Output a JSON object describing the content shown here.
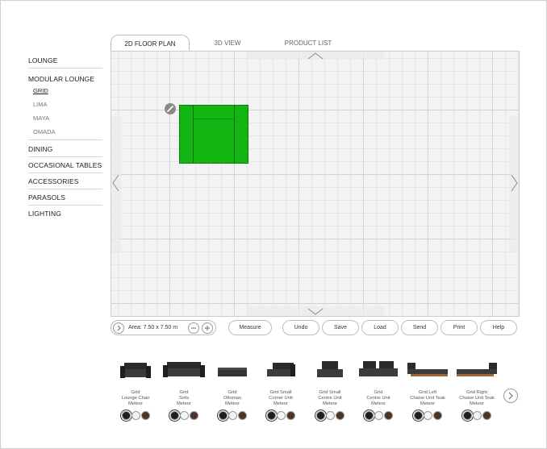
{
  "sidebar": {
    "categories": [
      {
        "label": "LOUNGE"
      },
      {
        "label": "MODULAR LOUNGE",
        "subitems": [
          "GRID",
          "LIMA",
          "MAYA",
          "OMADA"
        ]
      },
      {
        "label": "DINING"
      },
      {
        "label": "OCCASIONAL TABLES"
      },
      {
        "label": "ACCESSORIES"
      },
      {
        "label": "PARASOLS"
      },
      {
        "label": "LIGHTING"
      }
    ],
    "active_subitem": "GRID"
  },
  "tabs": [
    {
      "label": "2D FLOOR PLAN",
      "active": true
    },
    {
      "label": "3D VIEW",
      "active": false
    },
    {
      "label": "PRODUCT LIST",
      "active": false
    }
  ],
  "floor_plan": {
    "placed_item_color": "#13b513",
    "pan_arrows": [
      "chevron-up",
      "chevron-down",
      "chevron-left",
      "chevron-right"
    ]
  },
  "toolbar": {
    "area_label": "Area: 7.50 x 7.50 m",
    "buttons": [
      "Measure",
      "Undo",
      "Save",
      "Load",
      "Send",
      "Print",
      "Help"
    ]
  },
  "products": [
    {
      "line1": "Grid",
      "line2": "Lounge Chair",
      "line3": "Meteor"
    },
    {
      "line1": "Grid",
      "line2": "Sofa",
      "line3": "Meteor"
    },
    {
      "line1": "Grid",
      "line2": "Ottoman",
      "line3": "Meteor"
    },
    {
      "line1": "Grid Small",
      "line2": "Corner Unit",
      "line3": "Meteor"
    },
    {
      "line1": "Grid Small",
      "line2": "Centre Unit",
      "line3": "Meteor"
    },
    {
      "line1": "Grid",
      "line2": "Centre Unit",
      "line3": "Meteor"
    },
    {
      "line1": "Grid Left",
      "line2": "Chaise Unit Teak",
      "line3": "Meteor"
    },
    {
      "line1": "Grid Right",
      "line2": "Chaise Unit Teak",
      "line3": "Meteor"
    }
  ],
  "swatch_colors": [
    "#1e1e1e",
    "#f4f4f4",
    "#4a3528"
  ],
  "accent": "#13b513"
}
